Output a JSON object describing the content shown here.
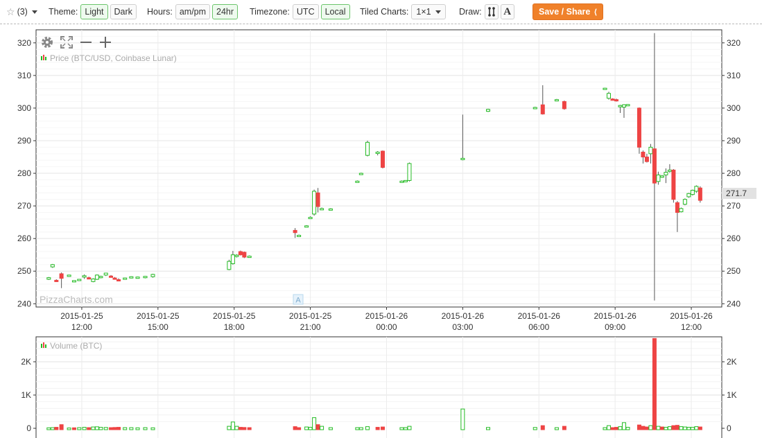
{
  "toolbar": {
    "favorites_count": "(3)",
    "theme_label": "Theme:",
    "theme_light": "Light",
    "theme_dark": "Dark",
    "hours_label": "Hours:",
    "hours_ampm": "am/pm",
    "hours_24": "24hr",
    "timezone_label": "Timezone:",
    "tz_utc": "UTC",
    "tz_local": "Local",
    "tiled_label": "Tiled Charts:",
    "tiled_value": "1×1",
    "draw_label": "Draw:",
    "draw_text_tool": "A",
    "share_label": "Save / Share",
    "accent_color": "#f0812a",
    "active_color": "#6ac46a"
  },
  "chart_data": [
    {
      "type": "candlestick",
      "legend": "Price (BTC/USD, Coinbase Lunar)",
      "watermark": "PizzaCharts.com",
      "last_price_label": "271.7",
      "y_ticks": [
        240,
        250,
        260,
        270,
        280,
        290,
        300,
        310,
        320
      ],
      "ylim": [
        239,
        324
      ],
      "x_range": [
        10.5,
        12.9
      ],
      "x_ticks": [
        {
          "t": 12,
          "date": "2015-01-25",
          "time": "12:00"
        },
        {
          "t": 15,
          "date": "2015-01-25",
          "time": "15:00"
        },
        {
          "t": 18,
          "date": "2015-01-25",
          "time": "18:00"
        },
        {
          "t": 21,
          "date": "2015-01-25",
          "time": "21:00"
        },
        {
          "t": 24,
          "date": "2015-01-26",
          "time": "00:00"
        },
        {
          "t": 27,
          "date": "2015-01-26",
          "time": "03:00"
        },
        {
          "t": 30,
          "date": "2015-01-26",
          "time": "06:00"
        },
        {
          "t": 33,
          "date": "2015-01-26",
          "time": "09:00"
        },
        {
          "t": 36,
          "date": "2015-01-26",
          "time": "12:00"
        }
      ],
      "up_color": "#22bb22",
      "down_color": "#ee4444",
      "candles": [
        {
          "t": 10.7,
          "o": 247.5,
          "h": 248.2,
          "l": 247.3,
          "c": 248.0
        },
        {
          "t": 10.85,
          "o": 251.3,
          "h": 252.2,
          "l": 251.0,
          "c": 252.0
        },
        {
          "t": 11.0,
          "o": 247.2,
          "h": 247.5,
          "l": 246.7,
          "c": 246.9
        },
        {
          "t": 11.2,
          "o": 249.2,
          "h": 249.6,
          "l": 244.8,
          "c": 247.8
        },
        {
          "t": 11.5,
          "o": 248.6,
          "h": 248.9,
          "l": 248.3,
          "c": 248.8
        },
        {
          "t": 11.7,
          "o": 247.0,
          "h": 247.2,
          "l": 246.8,
          "c": 247.1
        },
        {
          "t": 11.9,
          "o": 247.3,
          "h": 247.5,
          "l": 247.1,
          "c": 247.5
        },
        {
          "t": 12.1,
          "o": 248.3,
          "h": 249.0,
          "l": 247.6,
          "c": 248.6
        },
        {
          "t": 12.28,
          "o": 248.0,
          "h": 248.3,
          "l": 247.7,
          "c": 247.8
        },
        {
          "t": 12.45,
          "o": 246.8,
          "h": 247.8,
          "l": 246.6,
          "c": 247.6
        },
        {
          "t": 12.6,
          "o": 247.5,
          "h": 249.0,
          "l": 247.3,
          "c": 248.8
        },
        {
          "t": 12.75,
          "o": 248.1,
          "h": 248.6,
          "l": 247.8,
          "c": 248.4
        },
        {
          "t": 12.95,
          "o": 248.8,
          "h": 249.5,
          "l": 248.5,
          "c": 249.4
        },
        {
          "t": 13.15,
          "o": 248.5,
          "h": 248.8,
          "l": 248.2,
          "c": 248.3
        },
        {
          "t": 13.3,
          "o": 247.9,
          "h": 248.2,
          "l": 247.6,
          "c": 247.7
        },
        {
          "t": 13.45,
          "o": 247.4,
          "h": 247.8,
          "l": 246.9,
          "c": 247.0
        },
        {
          "t": 13.7,
          "o": 247.6,
          "h": 248.0,
          "l": 247.4,
          "c": 247.9
        },
        {
          "t": 13.95,
          "o": 248.0,
          "h": 248.4,
          "l": 247.8,
          "c": 248.3
        },
        {
          "t": 14.2,
          "o": 247.9,
          "h": 248.3,
          "l": 247.7,
          "c": 248.2
        },
        {
          "t": 14.5,
          "o": 248.2,
          "h": 248.5,
          "l": 247.8,
          "c": 248.4
        },
        {
          "t": 14.8,
          "o": 248.3,
          "h": 249.2,
          "l": 248.0,
          "c": 249.0
        },
        {
          "t": 17.8,
          "o": 250.5,
          "h": 253.5,
          "l": 250.3,
          "c": 253.0
        },
        {
          "t": 17.95,
          "o": 252.3,
          "h": 256.2,
          "l": 252.0,
          "c": 255.0
        },
        {
          "t": 18.1,
          "o": 254.5,
          "h": 255.2,
          "l": 254.2,
          "c": 254.9
        },
        {
          "t": 18.25,
          "o": 256.0,
          "h": 256.3,
          "l": 254.8,
          "c": 255.0
        },
        {
          "t": 18.4,
          "o": 255.8,
          "h": 256.0,
          "l": 254.0,
          "c": 254.3
        },
        {
          "t": 18.6,
          "o": 254.5,
          "h": 254.8,
          "l": 254.3,
          "c": 254.6
        },
        {
          "t": 20.4,
          "o": 262.5,
          "h": 263.2,
          "l": 260.2,
          "c": 261.8
        },
        {
          "t": 20.55,
          "o": 260.8,
          "h": 261.2,
          "l": 260.5,
          "c": 261.0
        },
        {
          "t": 20.85,
          "o": 263.8,
          "h": 264.1,
          "l": 263.5,
          "c": 263.9
        },
        {
          "t": 21.0,
          "o": 266.3,
          "h": 266.8,
          "l": 266.0,
          "c": 266.5
        },
        {
          "t": 21.15,
          "o": 267.5,
          "h": 275.0,
          "l": 267.0,
          "c": 274.5
        },
        {
          "t": 21.3,
          "o": 274.0,
          "h": 275.5,
          "l": 268.0,
          "c": 269.8
        },
        {
          "t": 21.45,
          "o": 269.0,
          "h": 269.5,
          "l": 268.8,
          "c": 269.2
        },
        {
          "t": 21.8,
          "o": 269.0,
          "h": 269.3,
          "l": 268.8,
          "c": 269.1
        },
        {
          "t": 22.85,
          "o": 277.4,
          "h": 277.8,
          "l": 277.2,
          "c": 277.6
        },
        {
          "t": 23.0,
          "o": 279.8,
          "h": 280.2,
          "l": 279.6,
          "c": 280.0
        },
        {
          "t": 23.25,
          "o": 285.5,
          "h": 290.0,
          "l": 285.2,
          "c": 289.5
        },
        {
          "t": 23.65,
          "o": 286.2,
          "h": 286.8,
          "l": 285.5,
          "c": 286.5
        },
        {
          "t": 23.85,
          "o": 286.8,
          "h": 287.0,
          "l": 281.5,
          "c": 281.8
        },
        {
          "t": 24.6,
          "o": 277.5,
          "h": 277.8,
          "l": 277.2,
          "c": 277.6
        },
        {
          "t": 24.75,
          "o": 277.6,
          "h": 277.9,
          "l": 277.3,
          "c": 277.8
        },
        {
          "t": 24.9,
          "o": 277.8,
          "h": 283.3,
          "l": 277.5,
          "c": 283.0
        },
        {
          "t": 27.0,
          "o": 284.2,
          "h": 298.0,
          "l": 284.0,
          "c": 284.6
        },
        {
          "t": 28.0,
          "o": 299.0,
          "h": 299.8,
          "l": 298.8,
          "c": 299.6
        },
        {
          "t": 29.85,
          "o": 300.0,
          "h": 300.4,
          "l": 299.8,
          "c": 300.2
        },
        {
          "t": 30.15,
          "o": 301.0,
          "h": 307.0,
          "l": 298.0,
          "c": 298.2
        },
        {
          "t": 30.7,
          "o": 302.4,
          "h": 302.8,
          "l": 302.2,
          "c": 302.6
        },
        {
          "t": 31.0,
          "o": 302.0,
          "h": 302.3,
          "l": 299.5,
          "c": 299.8
        },
        {
          "t": 32.6,
          "o": 306.0,
          "h": 306.2,
          "l": 305.8,
          "c": 306.1
        },
        {
          "t": 32.75,
          "o": 303.0,
          "h": 305.0,
          "l": 302.6,
          "c": 304.5
        },
        {
          "t": 32.9,
          "o": 302.8,
          "h": 303.0,
          "l": 302.5,
          "c": 302.6
        },
        {
          "t": 33.05,
          "o": 302.6,
          "h": 302.9,
          "l": 302.0,
          "c": 302.2
        },
        {
          "t": 33.2,
          "o": 300.5,
          "h": 301.0,
          "l": 298.5,
          "c": 300.8
        },
        {
          "t": 33.35,
          "o": 300.3,
          "h": 301.2,
          "l": 297.0,
          "c": 301.0
        },
        {
          "t": 33.5,
          "o": 301.0,
          "h": 301.2,
          "l": 300.8,
          "c": 301.1
        },
        {
          "t": 33.95,
          "o": 300.0,
          "h": 300.2,
          "l": 286.0,
          "c": 288.0
        },
        {
          "t": 34.1,
          "o": 286.5,
          "h": 287.0,
          "l": 283.0,
          "c": 285.0
        },
        {
          "t": 34.25,
          "o": 285.0,
          "h": 286.0,
          "l": 283.3,
          "c": 283.6
        },
        {
          "t": 34.4,
          "o": 286.0,
          "h": 289.0,
          "l": 283.0,
          "c": 288.0
        },
        {
          "t": 34.55,
          "o": 287.5,
          "h": 323.0,
          "l": 241.0,
          "c": 277.0
        },
        {
          "t": 34.7,
          "o": 277.5,
          "h": 280.5,
          "l": 276.5,
          "c": 279.5
        },
        {
          "t": 34.85,
          "o": 279.0,
          "h": 279.5,
          "l": 278.6,
          "c": 279.2
        },
        {
          "t": 35.0,
          "o": 279.5,
          "h": 281.5,
          "l": 277.0,
          "c": 280.3
        },
        {
          "t": 35.15,
          "o": 280.8,
          "h": 282.8,
          "l": 280.2,
          "c": 281.0
        },
        {
          "t": 35.3,
          "o": 281.0,
          "h": 281.3,
          "l": 271.0,
          "c": 272.0
        },
        {
          "t": 35.45,
          "o": 271.0,
          "h": 271.5,
          "l": 262.0,
          "c": 268.0
        },
        {
          "t": 35.6,
          "o": 268.2,
          "h": 269.5,
          "l": 268.0,
          "c": 269.2
        },
        {
          "t": 35.75,
          "o": 270.5,
          "h": 272.3,
          "l": 270.2,
          "c": 272.0
        },
        {
          "t": 35.9,
          "o": 272.8,
          "h": 274.0,
          "l": 272.5,
          "c": 273.8
        },
        {
          "t": 36.05,
          "o": 273.5,
          "h": 275.0,
          "l": 273.2,
          "c": 274.8
        },
        {
          "t": 36.2,
          "o": 274.5,
          "h": 276.3,
          "l": 274.0,
          "c": 276.0
        },
        {
          "t": 36.35,
          "o": 275.5,
          "h": 276.0,
          "l": 271.0,
          "c": 271.7
        }
      ]
    },
    {
      "type": "bar",
      "legend": "Volume (BTC)",
      "y_ticks": [
        {
          "v": 0,
          "label": "0"
        },
        {
          "v": 1000,
          "label": "1K"
        },
        {
          "v": 2000,
          "label": "2K"
        }
      ],
      "ylim": [
        0,
        2750
      ],
      "bars": [
        {
          "t": 10.7,
          "v": 15,
          "up": true
        },
        {
          "t": 10.85,
          "v": 20,
          "up": true
        },
        {
          "t": 11.0,
          "v": 30,
          "up": false
        },
        {
          "t": 11.2,
          "v": 110,
          "up": false
        },
        {
          "t": 11.5,
          "v": 10,
          "up": true
        },
        {
          "t": 11.7,
          "v": 15,
          "up": false
        },
        {
          "t": 11.9,
          "v": 20,
          "up": true
        },
        {
          "t": 12.1,
          "v": 30,
          "up": true
        },
        {
          "t": 12.28,
          "v": 20,
          "up": false
        },
        {
          "t": 12.45,
          "v": 40,
          "up": true
        },
        {
          "t": 12.6,
          "v": 45,
          "up": true
        },
        {
          "t": 12.75,
          "v": 30,
          "up": true
        },
        {
          "t": 12.95,
          "v": 25,
          "up": true
        },
        {
          "t": 13.15,
          "v": 20,
          "up": false
        },
        {
          "t": 13.3,
          "v": 25,
          "up": false
        },
        {
          "t": 13.45,
          "v": 30,
          "up": false
        },
        {
          "t": 13.7,
          "v": 20,
          "up": true
        },
        {
          "t": 13.95,
          "v": 20,
          "up": true
        },
        {
          "t": 14.2,
          "v": 15,
          "up": true
        },
        {
          "t": 14.5,
          "v": 20,
          "up": true
        },
        {
          "t": 14.8,
          "v": 15,
          "up": true
        },
        {
          "t": 17.8,
          "v": 60,
          "up": true
        },
        {
          "t": 17.95,
          "v": 190,
          "up": true
        },
        {
          "t": 18.1,
          "v": 60,
          "up": true
        },
        {
          "t": 18.25,
          "v": 30,
          "up": false
        },
        {
          "t": 18.4,
          "v": 25,
          "up": false
        },
        {
          "t": 18.6,
          "v": 20,
          "up": false
        },
        {
          "t": 20.4,
          "v": 50,
          "up": false
        },
        {
          "t": 20.55,
          "v": 20,
          "up": false
        },
        {
          "t": 20.85,
          "v": 40,
          "up": true
        },
        {
          "t": 21.0,
          "v": 30,
          "up": true
        },
        {
          "t": 21.15,
          "v": 320,
          "up": true
        },
        {
          "t": 21.3,
          "v": 110,
          "up": false
        },
        {
          "t": 21.45,
          "v": 60,
          "up": true
        },
        {
          "t": 21.8,
          "v": 20,
          "up": true
        },
        {
          "t": 22.85,
          "v": 20,
          "up": true
        },
        {
          "t": 23.0,
          "v": 20,
          "up": true
        },
        {
          "t": 23.25,
          "v": 50,
          "up": true
        },
        {
          "t": 23.65,
          "v": 30,
          "up": false
        },
        {
          "t": 23.85,
          "v": 40,
          "up": false
        },
        {
          "t": 24.6,
          "v": 20,
          "up": true
        },
        {
          "t": 24.75,
          "v": 20,
          "up": true
        },
        {
          "t": 24.9,
          "v": 60,
          "up": true
        },
        {
          "t": 27.0,
          "v": 580,
          "up": true
        },
        {
          "t": 28.0,
          "v": 25,
          "up": true
        },
        {
          "t": 29.85,
          "v": 25,
          "up": true
        },
        {
          "t": 30.15,
          "v": 80,
          "up": false
        },
        {
          "t": 30.7,
          "v": 20,
          "up": true
        },
        {
          "t": 31.0,
          "v": 60,
          "up": false
        },
        {
          "t": 32.6,
          "v": 20,
          "up": true
        },
        {
          "t": 32.75,
          "v": 80,
          "up": true
        },
        {
          "t": 32.9,
          "v": 20,
          "up": false
        },
        {
          "t": 33.05,
          "v": 30,
          "up": false
        },
        {
          "t": 33.2,
          "v": 50,
          "up": true
        },
        {
          "t": 33.35,
          "v": 170,
          "up": true
        },
        {
          "t": 33.5,
          "v": 30,
          "up": true
        },
        {
          "t": 33.95,
          "v": 100,
          "up": false
        },
        {
          "t": 34.1,
          "v": 60,
          "up": false
        },
        {
          "t": 34.25,
          "v": 40,
          "up": false
        },
        {
          "t": 34.4,
          "v": 80,
          "up": true
        },
        {
          "t": 34.55,
          "v": 2700,
          "up": false
        },
        {
          "t": 34.7,
          "v": 60,
          "up": true
        },
        {
          "t": 34.85,
          "v": 40,
          "up": false
        },
        {
          "t": 35.0,
          "v": 30,
          "up": true
        },
        {
          "t": 35.15,
          "v": 50,
          "up": true
        },
        {
          "t": 35.3,
          "v": 80,
          "up": false
        },
        {
          "t": 35.45,
          "v": 90,
          "up": false
        },
        {
          "t": 35.6,
          "v": 50,
          "up": true
        },
        {
          "t": 35.75,
          "v": 40,
          "up": true
        },
        {
          "t": 35.9,
          "v": 30,
          "up": true
        },
        {
          "t": 36.05,
          "v": 30,
          "up": true
        },
        {
          "t": 36.2,
          "v": 50,
          "up": true
        },
        {
          "t": 36.35,
          "v": 40,
          "up": false
        }
      ]
    }
  ]
}
